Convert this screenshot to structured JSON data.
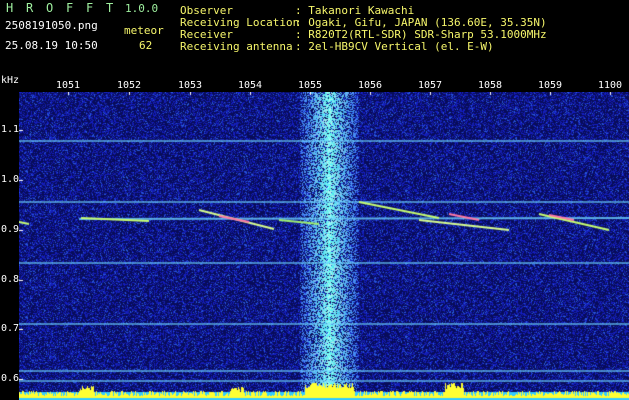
{
  "app": {
    "title_letters": [
      "H",
      "R",
      "O",
      "F",
      "F",
      "T"
    ],
    "version": "1.0.0"
  },
  "capture": {
    "filename": "2508191050.png",
    "datetime": "25.08.19 10:50",
    "meteor_label": "meteor",
    "meteor_count": "62"
  },
  "info": [
    {
      "label": "Observer",
      "value": ": Takanori Kawachi"
    },
    {
      "label": "Receiving Location",
      "value": ": Ogaki, Gifu, JAPAN (136.60E, 35.35N)"
    },
    {
      "label": "Receiver",
      "value": ": R820T2(RTL-SDR) SDR-Sharp 53.1000MHz"
    },
    {
      "label": "Receiving antenna",
      "value": ": 2el-HB9CV Vertical (el. E-W)"
    }
  ],
  "axes": {
    "y_unit": "kHz",
    "x_ticks": [
      "1051",
      "1052",
      "1053",
      "1054",
      "1055",
      "1056",
      "1057",
      "1058",
      "1059",
      "1100"
    ],
    "y_ticks": [
      "1.1",
      "1.0",
      "0.9",
      "0.8",
      "0.7",
      "0.6"
    ]
  },
  "colors": {
    "background_noise": "#0a0f6e",
    "signal_band": "#3fa0ff",
    "carrier_line": "#6fd6ff",
    "meteor_trace": "#c8ff70",
    "activity_bar": "#ffff33",
    "baseline": "#33ccff"
  }
}
